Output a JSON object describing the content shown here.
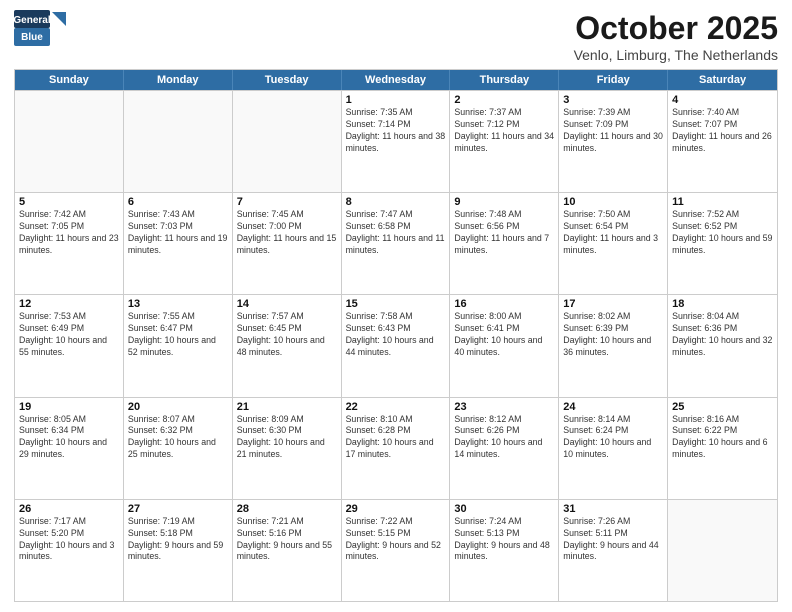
{
  "logo": {
    "line1": "General",
    "line2": "Blue"
  },
  "header": {
    "month": "October 2025",
    "location": "Venlo, Limburg, The Netherlands"
  },
  "days_of_week": [
    "Sunday",
    "Monday",
    "Tuesday",
    "Wednesday",
    "Thursday",
    "Friday",
    "Saturday"
  ],
  "weeks": [
    [
      {
        "day": "",
        "sunrise": "",
        "sunset": "",
        "daylight": ""
      },
      {
        "day": "",
        "sunrise": "",
        "sunset": "",
        "daylight": ""
      },
      {
        "day": "",
        "sunrise": "",
        "sunset": "",
        "daylight": ""
      },
      {
        "day": "1",
        "sunrise": "Sunrise: 7:35 AM",
        "sunset": "Sunset: 7:14 PM",
        "daylight": "Daylight: 11 hours and 38 minutes."
      },
      {
        "day": "2",
        "sunrise": "Sunrise: 7:37 AM",
        "sunset": "Sunset: 7:12 PM",
        "daylight": "Daylight: 11 hours and 34 minutes."
      },
      {
        "day": "3",
        "sunrise": "Sunrise: 7:39 AM",
        "sunset": "Sunset: 7:09 PM",
        "daylight": "Daylight: 11 hours and 30 minutes."
      },
      {
        "day": "4",
        "sunrise": "Sunrise: 7:40 AM",
        "sunset": "Sunset: 7:07 PM",
        "daylight": "Daylight: 11 hours and 26 minutes."
      }
    ],
    [
      {
        "day": "5",
        "sunrise": "Sunrise: 7:42 AM",
        "sunset": "Sunset: 7:05 PM",
        "daylight": "Daylight: 11 hours and 23 minutes."
      },
      {
        "day": "6",
        "sunrise": "Sunrise: 7:43 AM",
        "sunset": "Sunset: 7:03 PM",
        "daylight": "Daylight: 11 hours and 19 minutes."
      },
      {
        "day": "7",
        "sunrise": "Sunrise: 7:45 AM",
        "sunset": "Sunset: 7:00 PM",
        "daylight": "Daylight: 11 hours and 15 minutes."
      },
      {
        "day": "8",
        "sunrise": "Sunrise: 7:47 AM",
        "sunset": "Sunset: 6:58 PM",
        "daylight": "Daylight: 11 hours and 11 minutes."
      },
      {
        "day": "9",
        "sunrise": "Sunrise: 7:48 AM",
        "sunset": "Sunset: 6:56 PM",
        "daylight": "Daylight: 11 hours and 7 minutes."
      },
      {
        "day": "10",
        "sunrise": "Sunrise: 7:50 AM",
        "sunset": "Sunset: 6:54 PM",
        "daylight": "Daylight: 11 hours and 3 minutes."
      },
      {
        "day": "11",
        "sunrise": "Sunrise: 7:52 AM",
        "sunset": "Sunset: 6:52 PM",
        "daylight": "Daylight: 10 hours and 59 minutes."
      }
    ],
    [
      {
        "day": "12",
        "sunrise": "Sunrise: 7:53 AM",
        "sunset": "Sunset: 6:49 PM",
        "daylight": "Daylight: 10 hours and 55 minutes."
      },
      {
        "day": "13",
        "sunrise": "Sunrise: 7:55 AM",
        "sunset": "Sunset: 6:47 PM",
        "daylight": "Daylight: 10 hours and 52 minutes."
      },
      {
        "day": "14",
        "sunrise": "Sunrise: 7:57 AM",
        "sunset": "Sunset: 6:45 PM",
        "daylight": "Daylight: 10 hours and 48 minutes."
      },
      {
        "day": "15",
        "sunrise": "Sunrise: 7:58 AM",
        "sunset": "Sunset: 6:43 PM",
        "daylight": "Daylight: 10 hours and 44 minutes."
      },
      {
        "day": "16",
        "sunrise": "Sunrise: 8:00 AM",
        "sunset": "Sunset: 6:41 PM",
        "daylight": "Daylight: 10 hours and 40 minutes."
      },
      {
        "day": "17",
        "sunrise": "Sunrise: 8:02 AM",
        "sunset": "Sunset: 6:39 PM",
        "daylight": "Daylight: 10 hours and 36 minutes."
      },
      {
        "day": "18",
        "sunrise": "Sunrise: 8:04 AM",
        "sunset": "Sunset: 6:36 PM",
        "daylight": "Daylight: 10 hours and 32 minutes."
      }
    ],
    [
      {
        "day": "19",
        "sunrise": "Sunrise: 8:05 AM",
        "sunset": "Sunset: 6:34 PM",
        "daylight": "Daylight: 10 hours and 29 minutes."
      },
      {
        "day": "20",
        "sunrise": "Sunrise: 8:07 AM",
        "sunset": "Sunset: 6:32 PM",
        "daylight": "Daylight: 10 hours and 25 minutes."
      },
      {
        "day": "21",
        "sunrise": "Sunrise: 8:09 AM",
        "sunset": "Sunset: 6:30 PM",
        "daylight": "Daylight: 10 hours and 21 minutes."
      },
      {
        "day": "22",
        "sunrise": "Sunrise: 8:10 AM",
        "sunset": "Sunset: 6:28 PM",
        "daylight": "Daylight: 10 hours and 17 minutes."
      },
      {
        "day": "23",
        "sunrise": "Sunrise: 8:12 AM",
        "sunset": "Sunset: 6:26 PM",
        "daylight": "Daylight: 10 hours and 14 minutes."
      },
      {
        "day": "24",
        "sunrise": "Sunrise: 8:14 AM",
        "sunset": "Sunset: 6:24 PM",
        "daylight": "Daylight: 10 hours and 10 minutes."
      },
      {
        "day": "25",
        "sunrise": "Sunrise: 8:16 AM",
        "sunset": "Sunset: 6:22 PM",
        "daylight": "Daylight: 10 hours and 6 minutes."
      }
    ],
    [
      {
        "day": "26",
        "sunrise": "Sunrise: 7:17 AM",
        "sunset": "Sunset: 5:20 PM",
        "daylight": "Daylight: 10 hours and 3 minutes."
      },
      {
        "day": "27",
        "sunrise": "Sunrise: 7:19 AM",
        "sunset": "Sunset: 5:18 PM",
        "daylight": "Daylight: 9 hours and 59 minutes."
      },
      {
        "day": "28",
        "sunrise": "Sunrise: 7:21 AM",
        "sunset": "Sunset: 5:16 PM",
        "daylight": "Daylight: 9 hours and 55 minutes."
      },
      {
        "day": "29",
        "sunrise": "Sunrise: 7:22 AM",
        "sunset": "Sunset: 5:15 PM",
        "daylight": "Daylight: 9 hours and 52 minutes."
      },
      {
        "day": "30",
        "sunrise": "Sunrise: 7:24 AM",
        "sunset": "Sunset: 5:13 PM",
        "daylight": "Daylight: 9 hours and 48 minutes."
      },
      {
        "day": "31",
        "sunrise": "Sunrise: 7:26 AM",
        "sunset": "Sunset: 5:11 PM",
        "daylight": "Daylight: 9 hours and 44 minutes."
      },
      {
        "day": "",
        "sunrise": "",
        "sunset": "",
        "daylight": ""
      }
    ]
  ]
}
